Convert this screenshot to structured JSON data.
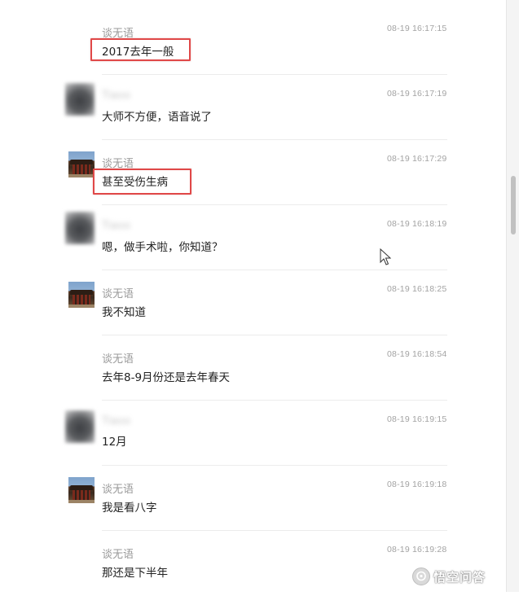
{
  "messages": [
    {
      "sender": "谈无语",
      "time": "08-19 16:17:15",
      "text": "2017去年一般",
      "avatar": "none",
      "highlighted": true
    },
    {
      "sender": "Tiaoo",
      "time": "08-19 16:17:19",
      "text": "大师不方便，语音说了",
      "avatar": "blurred-photo",
      "highlighted": false
    },
    {
      "sender": "谈无语",
      "time": "08-19 16:17:29",
      "text": "甚至受伤生病",
      "avatar": "temple-photo",
      "highlighted": true
    },
    {
      "sender": "Tiaoo",
      "time": "08-19 16:18:19",
      "text": "嗯，做手术啦，你知道？",
      "avatar": "blurred-photo",
      "highlighted": false
    },
    {
      "sender": "谈无语",
      "time": "08-19 16:18:25",
      "text": "我不知道",
      "avatar": "temple-photo",
      "highlighted": false
    },
    {
      "sender": "谈无语",
      "time": "08-19 16:18:54",
      "text": "去年8-9月份还是去年春天",
      "avatar": "none",
      "highlighted": false
    },
    {
      "sender": "Tiaoo",
      "time": "08-19 16:19:15",
      "text": "12月",
      "avatar": "blurred-photo",
      "highlighted": false
    },
    {
      "sender": "谈无语",
      "time": "08-19 16:19:18",
      "text": "我是看八字",
      "avatar": "temple-photo",
      "highlighted": false
    },
    {
      "sender": "谈无语",
      "time": "08-19 16:19:28",
      "text": "那还是下半年",
      "avatar": "none",
      "highlighted": false
    }
  ],
  "watermark": {
    "text": "悟空问答",
    "icon": "speech-bubble-icon"
  },
  "colors": {
    "highlight": "#e04848",
    "timestamp": "#a3a3a3",
    "sender": "#9a9a9a",
    "body_text": "#222222"
  }
}
